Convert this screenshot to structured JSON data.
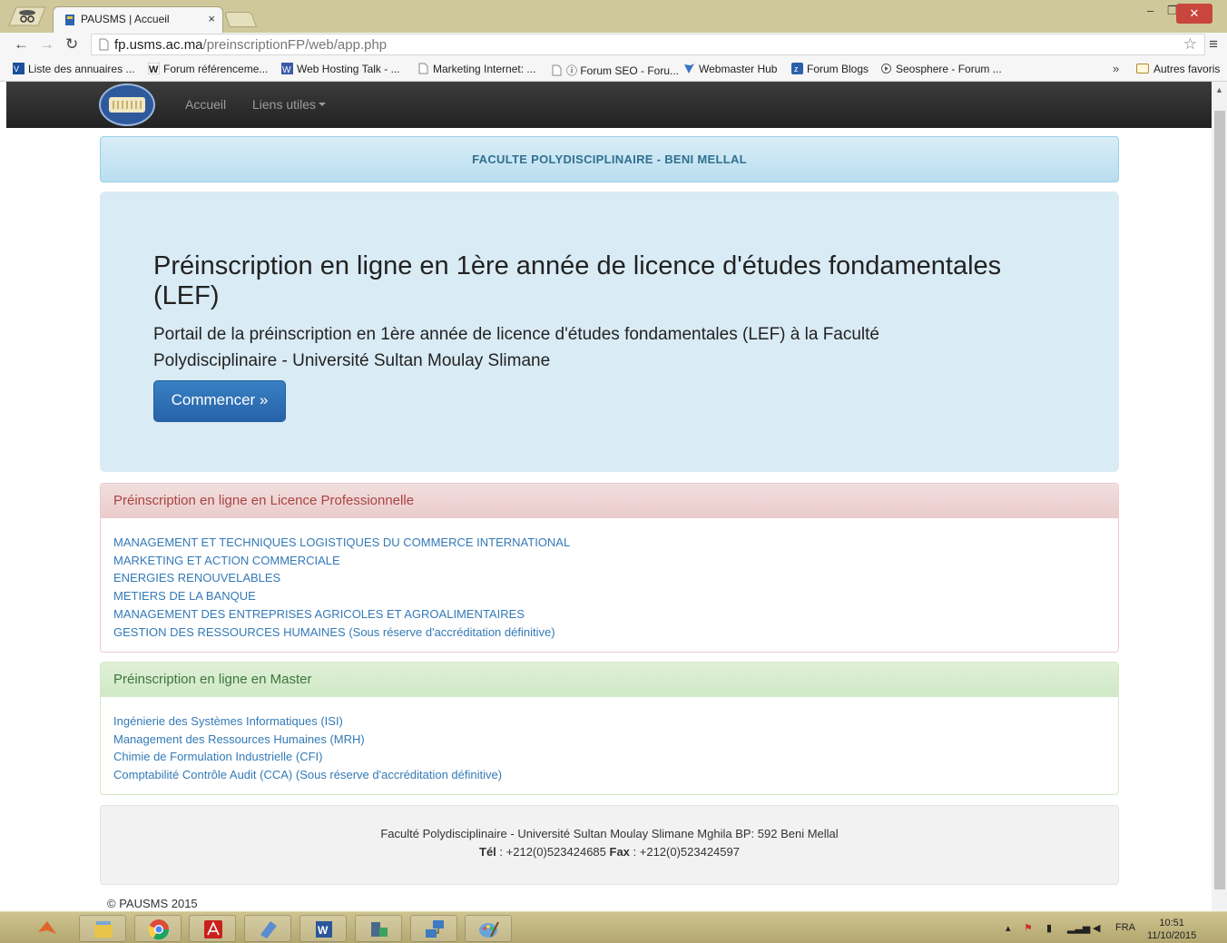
{
  "browser": {
    "tab_title": "PAUSMS | Accueil",
    "tab_close": "×",
    "url_host": "fp.usms.ac.ma",
    "url_path": "/preinscriptionFP/web/app.php",
    "bookmarks": [
      {
        "label": "Liste des annuaires ...",
        "icon_color": "#1b4f9c"
      },
      {
        "label": "Forum référenceme...",
        "icon_color": "#ffffff"
      },
      {
        "label": "Web Hosting Talk - ...",
        "icon_color": "#3b5ba8"
      },
      {
        "label": "Marketing Internet: ...",
        "icon_color": "#ffffff"
      },
      {
        "label": "ⓘ Forum SEO - Foru...",
        "icon_color": "#ffffff"
      },
      {
        "label": "Webmaster Hub",
        "icon_color": "#3a72c8"
      },
      {
        "label": "Forum Blogs",
        "icon_color": "#2b5fa8"
      },
      {
        "label": "Seosphere - Forum ...",
        "icon_color": "#555555"
      }
    ],
    "bookmarks_more": "»",
    "other_bookmarks": "Autres favoris"
  },
  "navbar": {
    "links": [
      "Accueil",
      "Liens utiles"
    ]
  },
  "header": {
    "title": "FACULTE POLYDISCIPLINAIRE - BENI MELLAL"
  },
  "jumbotron": {
    "heading": "Préinscription en ligne en 1ère année de licence d'études fondamentales (LEF)",
    "lead": "Portail de la préinscription en 1ère année de licence d'études fondamentales (LEF) à la Faculté Polydisciplinaire - Université Sultan Moulay Slimane",
    "button": "Commencer »"
  },
  "panel_lp": {
    "heading": "Préinscription en ligne en Licence Professionnelle",
    "items": [
      "MANAGEMENT ET TECHNIQUES LOGISTIQUES DU COMMERCE INTERNATIONAL",
      "MARKETING ET ACTION COMMERCIALE",
      "ENERGIES RENOUVELABLES",
      "METIERS DE LA BANQUE",
      "MANAGEMENT DES ENTREPRISES AGRICOLES ET AGROALIMENTAIRES",
      "GESTION DES RESSOURCES HUMAINES (Sous réserve d'accréditation définitive)"
    ]
  },
  "panel_master": {
    "heading": "Préinscription en ligne en Master",
    "items": [
      "Ingénierie des Systèmes Informatiques (ISI)",
      "Management des Ressources Humaines (MRH)",
      "Chimie de Formulation Industrielle (CFI)",
      "Comptabilité Contrôle Audit (CCA) (Sous réserve d'accréditation définitive)"
    ]
  },
  "footer": {
    "address": "Faculté Polydisciplinaire - Université Sultan Moulay Slimane Mghila BP: 592 Beni Mellal",
    "tel_label": "Tél",
    "tel_value": " : +212(0)523424685 ",
    "fax_label": "Fax",
    "fax_value": " : +212(0)523424597",
    "copyright": "© PAUSMS 2015"
  },
  "taskbar": {
    "language": "FRA",
    "time": "10:51",
    "date": "11/10/2015",
    "apps": [
      {
        "icon": "matlab-icon",
        "color": "#e0652a"
      },
      {
        "icon": "file-explorer-icon",
        "color": "#e7c44a"
      },
      {
        "icon": "chrome-icon",
        "color": "#dd4b39"
      },
      {
        "icon": "acrobat-icon",
        "color": "#c8211b"
      },
      {
        "icon": "app-cube-icon",
        "color": "#5a8ccf"
      },
      {
        "icon": "word-icon",
        "color": "#2b579a"
      },
      {
        "icon": "network-app-icon",
        "color": "#4a6a8a"
      },
      {
        "icon": "network-computers-icon",
        "color": "#3d7ac0"
      },
      {
        "icon": "paint-icon",
        "color": "#6aa3d8"
      }
    ]
  }
}
